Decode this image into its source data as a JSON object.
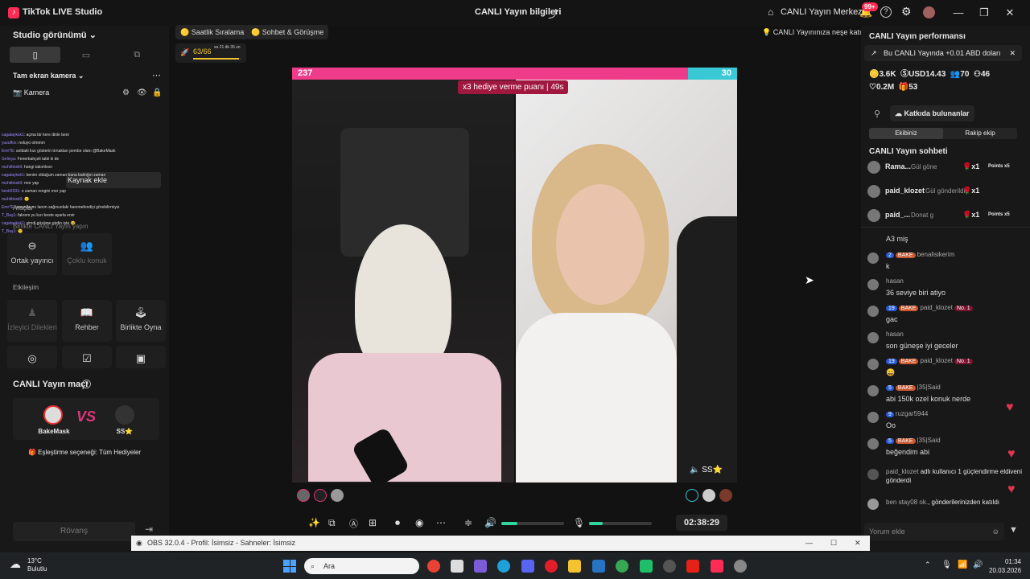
{
  "titlebar": {
    "app_name": "TikTok LIVE Studio",
    "live_info": "CANLI Yayın bilgileri",
    "live_center": "CANLI Yayın Merkezi",
    "notif_count": "99+"
  },
  "left": {
    "studio_view": "Studio görünümü",
    "fullscreen_camera": "Tam ekran kamera",
    "camera": "Kamera",
    "add_source": "Kaynak ekle",
    "tools_title": "Araçlar",
    "together_live": "Birlikte CANLI Yayın yapın",
    "cohost": "Ortak yayıncı",
    "multi_guest": "Çoklu konuk",
    "interaction": "Etkileşim",
    "viewer_wishes": "İzleyici Dilekleri",
    "guide": "Rehber",
    "play_together": "Birlikte Oyna",
    "match_title": "CANLI Yayın maçı",
    "player1": "BakeMask",
    "player2": "SS⭐",
    "vs": "VS",
    "match_option": "🎁 Eşleştirme seçeneği: Tüm Hediyeler",
    "rematch": "Rövanş",
    "overlay_chat": [
      {
        "user": "cagatayksk1",
        "text": ": açma bir kere dinle beni"
      },
      {
        "user": "yusuffox",
        "text": ": noluyo olmmm"
      },
      {
        "user": "Emr7E",
        "text": ": soldaki kızı gösterin tırnakları pembe olanı @BakeMask"
      },
      {
        "user": "Gelinya",
        "text": ": Fenerbahçeli tabii ki de"
      },
      {
        "user": "muhittinsk0",
        "text": ": hangi takımlısın"
      },
      {
        "user": "cagatayksk1",
        "text": ": benim oldağum zaman bana baktığın zaman"
      },
      {
        "user": "muhittinsk0",
        "text": ": mor yap"
      },
      {
        "user": "bestt2331",
        "text": ": o zaman rengini mor yap"
      },
      {
        "user": "muhittinsk0",
        "text": ": 🙂"
      },
      {
        "user": "Emr7E",
        "text": ": zorunda mı lanım sağınızdaki hanımefendiyi görebilirmiyiz"
      },
      {
        "user": "T_Baş1",
        "text": ": fakrem yu kızı beste ayarla ersir"
      },
      {
        "user": "cagatayksk1",
        "text": ": şimdi gözüme girdin işte 😂"
      },
      {
        "user": "T_Baş1",
        "text": ": 🙂"
      }
    ]
  },
  "top": {
    "hourly_rank": "Saatlik Sıralama",
    "chat_meet": "Sohbet & Görüşme",
    "cheer": "CANLI Yayınınıza neşe katın",
    "progress": "63/66",
    "progress_time": "sa 21 dk 35 sn",
    "progress_fraction": 0.95
  },
  "battle": {
    "score_left": "237",
    "score_right": "30",
    "multiplier": "x3 hediye verme puanı",
    "timer": "49s",
    "guest_name": "SS⭐",
    "pink_fraction": 0.89
  },
  "controls": {
    "elapsed": "02:38:29",
    "volume_fraction": 0.25,
    "mic_fraction": 0.22
  },
  "right": {
    "perf_title": "CANLI Yayın performansı",
    "earning_note": "Bu CANLI Yayında +0.01 ABD doları",
    "coins": "3.6K",
    "usd": "USD14.43",
    "viewers": "70",
    "new_followers": "46",
    "likes": "0.2M",
    "gifts": "53",
    "contributors": "Katkıda bulunanlar",
    "team_mine": "Ekibiniz",
    "team_rival": "Rakip ekip",
    "chat_title": "CANLI Yayın sohbeti",
    "pinned": [
      {
        "user": "Rama...",
        "action": "Gül göne",
        "count": "x1",
        "points": "Points x5"
      },
      {
        "user": "paid_klozet",
        "action": "Gül gönderildi",
        "count": "x1",
        "points": ""
      },
      {
        "user": "paid_...",
        "action": "Donat g",
        "count": "x1",
        "points": "Points x5"
      }
    ],
    "messages": [
      {
        "user": "",
        "level": "",
        "bake": "",
        "no1": "",
        "text": "A3 miş"
      },
      {
        "user": "benalisikerim",
        "level": "2",
        "bake": "BAKE",
        "no1": "",
        "text": "k"
      },
      {
        "user": "hasan",
        "level": "",
        "bake": "",
        "no1": "",
        "text": "36 seviye biri atiyo"
      },
      {
        "user": "paid_klozet",
        "level": "19",
        "bake": "BAKE",
        "no1": "No. 1",
        "text": "gac"
      },
      {
        "user": "hasan",
        "level": "",
        "bake": "",
        "no1": "",
        "text": "son güneşe iyi geceler"
      },
      {
        "user": "paid_klozet",
        "level": "19",
        "bake": "BAKE",
        "no1": "No. 1",
        "text": "😄"
      },
      {
        "user": "|35|Said",
        "level": "5",
        "bake": "BAKE",
        "no1": "",
        "text": "abi 150k ozel konuk nerde"
      },
      {
        "user": "ruzgar5944",
        "level": "9",
        "bake": "",
        "no1": "",
        "text": "Oo"
      },
      {
        "user": "|35|Said",
        "level": "5",
        "bake": "BAKE",
        "no1": "",
        "text": "beğendim abi"
      }
    ],
    "system_msg_user": "paid_klozet",
    "system_msg": "adlı kullanıcı 1 güçlendirme eldiveni gönderdi",
    "joined_user": "ben stay08 ok.",
    "joined_msg": ", gönderilerinizden katıldı",
    "comment_placeholder": "Yorum ekle"
  },
  "obs": {
    "title": "OBS 32.0.4 - Profil: İsimsiz - Sahneler: İsimsiz"
  },
  "taskbar": {
    "temp": "13°C",
    "weather": "Bulutlu",
    "search": "Ara",
    "time": "01:34",
    "date": "20.03.2026"
  }
}
